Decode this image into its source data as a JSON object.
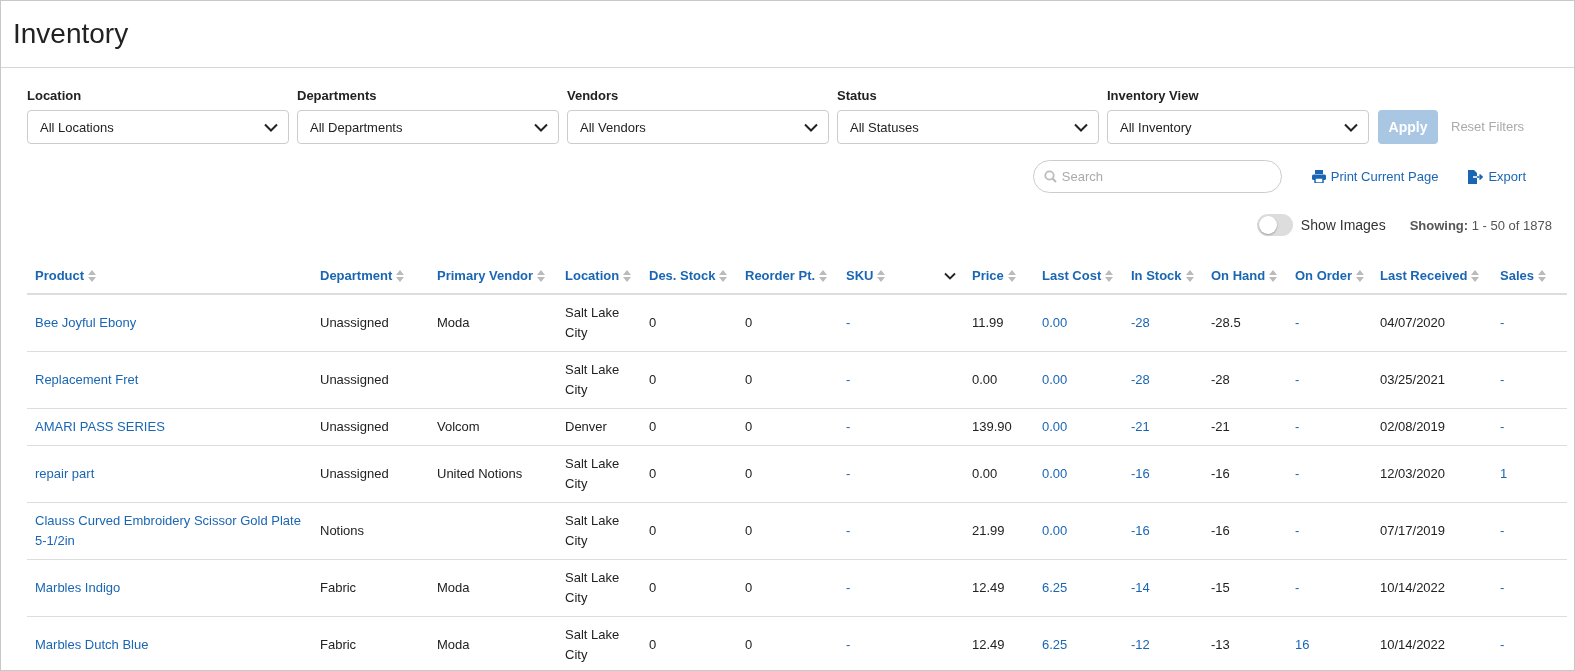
{
  "page": {
    "title": "Inventory"
  },
  "filters": [
    {
      "label": "Location",
      "value": "All Locations"
    },
    {
      "label": "Departments",
      "value": "All Departments"
    },
    {
      "label": "Vendors",
      "value": "All Vendors"
    },
    {
      "label": "Status",
      "value": "All Statuses"
    },
    {
      "label": "Inventory View",
      "value": "All Inventory"
    }
  ],
  "apply_button": {
    "label": "Apply",
    "disabled": true
  },
  "reset_link": {
    "label": "Reset Filters",
    "disabled": true
  },
  "search": {
    "placeholder": "Search"
  },
  "actions": [
    {
      "label": "Print Current Page",
      "kind": "print"
    },
    {
      "label": "Export",
      "kind": "export"
    }
  ],
  "show_images": {
    "label": "Show Images",
    "on": false
  },
  "showing": {
    "label": "Showing:",
    "value": "1 - 50 of 1878"
  },
  "table": {
    "columns": [
      {
        "label": "Product",
        "kind": "link",
        "picker": false
      },
      {
        "label": "Department",
        "kind": "plain",
        "picker": false
      },
      {
        "label": "Primary Vendor",
        "kind": "plain",
        "picker": false
      },
      {
        "label": "Location",
        "kind": "plain",
        "picker": false
      },
      {
        "label": "Des. Stock",
        "kind": "plain",
        "picker": false
      },
      {
        "label": "Reorder Pt.",
        "kind": "plain",
        "picker": false
      },
      {
        "label": "SKU",
        "kind": "link",
        "picker": true
      },
      {
        "label": "Price",
        "kind": "plain",
        "picker": false
      },
      {
        "label": "Last Cost",
        "kind": "link",
        "picker": false
      },
      {
        "label": "In Stock",
        "kind": "link",
        "picker": false
      },
      {
        "label": "On Hand",
        "kind": "plain",
        "picker": false
      },
      {
        "label": "On Order",
        "kind": "link",
        "picker": false
      },
      {
        "label": "Last Received",
        "kind": "plain",
        "picker": false
      },
      {
        "label": "Sales",
        "kind": "link",
        "picker": false
      }
    ],
    "rows": [
      [
        "Bee Joyful Ebony",
        "Unassigned",
        "Moda",
        "Salt Lake City",
        "0",
        "0",
        "-",
        "11.99",
        "0.00",
        "-28",
        "-28.5",
        "-",
        "04/07/2020",
        "-"
      ],
      [
        "Replacement Fret",
        "Unassigned",
        "",
        "Salt Lake City",
        "0",
        "0",
        "-",
        "0.00",
        "0.00",
        "-28",
        "-28",
        "-",
        "03/25/2021",
        "-"
      ],
      [
        "AMARI PASS SERIES",
        "Unassigned",
        "Volcom",
        "Denver",
        "0",
        "0",
        "-",
        "139.90",
        "0.00",
        "-21",
        "-21",
        "-",
        "02/08/2019",
        "-"
      ],
      [
        "repair part",
        "Unassigned",
        "United Notions",
        "Salt Lake City",
        "0",
        "0",
        "-",
        "0.00",
        "0.00",
        "-16",
        "-16",
        "-",
        "12/03/2020",
        "1"
      ],
      [
        "Clauss Curved Embroidery Scissor Gold Plate 5-1/2in",
        "Notions",
        "",
        "Salt Lake City",
        "0",
        "0",
        "-",
        "21.99",
        "0.00",
        "-16",
        "-16",
        "-",
        "07/17/2019",
        "-"
      ],
      [
        "Marbles Indigo",
        "Fabric",
        "Moda",
        "Salt Lake City",
        "0",
        "0",
        "-",
        "12.49",
        "6.25",
        "-14",
        "-15",
        "-",
        "10/14/2022",
        "-"
      ],
      [
        "Marbles Dutch Blue",
        "Fabric",
        "Moda",
        "Salt Lake City",
        "0",
        "0",
        "-",
        "12.49",
        "6.25",
        "-12",
        "-13",
        "16",
        "10/14/2022",
        "-"
      ]
    ]
  }
}
